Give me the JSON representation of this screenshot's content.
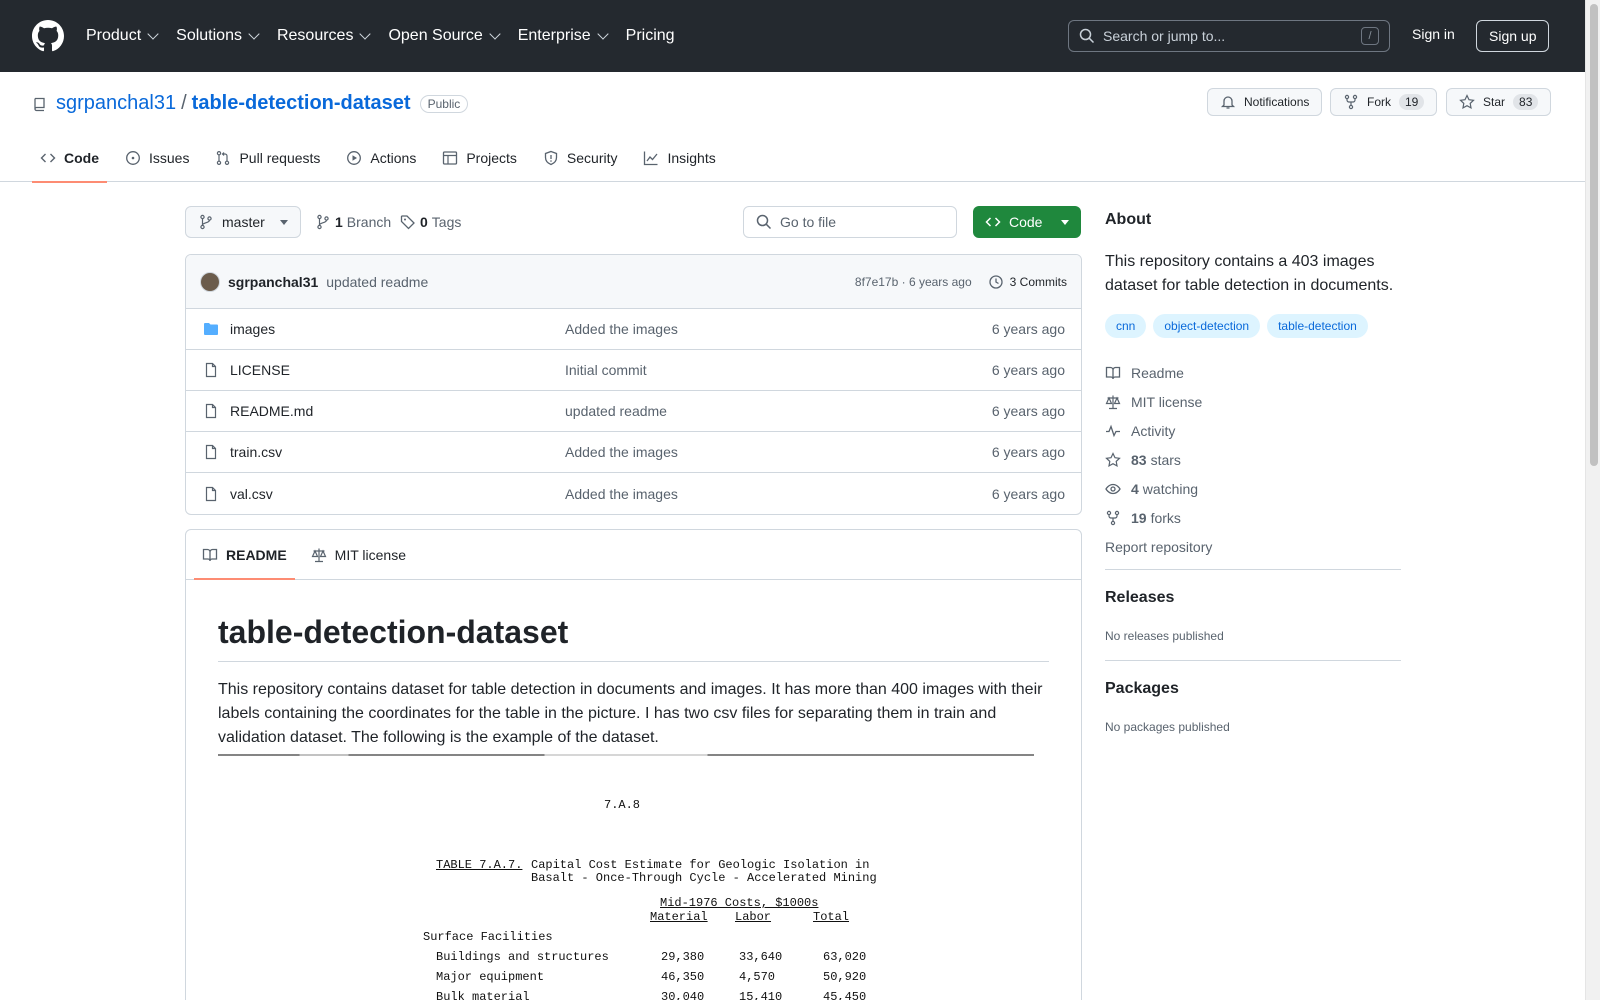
{
  "header": {
    "nav": [
      "Product",
      "Solutions",
      "Resources",
      "Open Source",
      "Enterprise",
      "Pricing"
    ],
    "search_placeholder": "Search or jump to...",
    "search_key": "/",
    "signin": "Sign in",
    "signup": "Sign up"
  },
  "repo": {
    "owner": "sgrpanchal31",
    "separator": "/",
    "name": "table-detection-dataset",
    "visibility": "Public",
    "notifications": "Notifications",
    "fork_label": "Fork",
    "fork_count": "19",
    "star_label": "Star",
    "star_count": "83",
    "tabs": [
      "Code",
      "Issues",
      "Pull requests",
      "Actions",
      "Projects",
      "Security",
      "Insights"
    ]
  },
  "branchbar": {
    "branch": "master",
    "branch_count": "1",
    "branch_word": "Branch",
    "tag_count": "0",
    "tag_word": "Tags",
    "goto_placeholder": "Go to file",
    "code_btn": "Code"
  },
  "commit": {
    "author": "sgrpanchal31",
    "message": "updated readme",
    "meta": "8f7e17b · 6 years ago",
    "commits": "3 Commits"
  },
  "files": [
    {
      "name": "images",
      "type": "folder",
      "message": "Added the images",
      "age": "6 years ago"
    },
    {
      "name": "LICENSE",
      "type": "file",
      "message": "Initial commit",
      "age": "6 years ago"
    },
    {
      "name": "README.md",
      "type": "file",
      "message": "updated readme",
      "age": "6 years ago"
    },
    {
      "name": "train.csv",
      "type": "file",
      "message": "Added the images",
      "age": "6 years ago"
    },
    {
      "name": "val.csv",
      "type": "file",
      "message": "Added the images",
      "age": "6 years ago"
    }
  ],
  "readme": {
    "tabs": [
      "README",
      "MIT license"
    ],
    "title": "table-detection-dataset",
    "paragraph": "This repository contains dataset for table detection in documents and images. It has more than 400 images with their labels containing the coordinates for the table in the picture. I has two csv files for separating them in train and validation dataset. The following is the example of the dataset.",
    "scan": {
      "page_no": "7.A.8",
      "table_ref": "TABLE 7.A.7.",
      "caption_1": "Capital Cost Estimate for Geologic Isolation in",
      "caption_2": "Basalt - Once-Through Cycle - Accelerated Mining",
      "costs_header": "Mid-1976 Costs, $1000s",
      "col_material": "Material",
      "col_labor": "Labor",
      "col_total": "Total",
      "section": "Surface Facilities",
      "rows": [
        {
          "label": "Buildings and structures",
          "material": "29,380",
          "labor": "33,640",
          "total": "63,020"
        },
        {
          "label": "Major equipment",
          "material": "46,350",
          "labor": "4,570",
          "total": "50,920"
        },
        {
          "label": "Bulk material",
          "material": "30,040",
          "labor": "15,410",
          "total": "45,450"
        }
      ]
    }
  },
  "sidebar": {
    "about_title": "About",
    "description": "This repository contains a 403 images dataset for table detection in documents.",
    "topics": [
      "cnn",
      "object-detection",
      "table-detection"
    ],
    "readme": "Readme",
    "license": "MIT license",
    "activity": "Activity",
    "stars_count": "83",
    "stars_word": "stars",
    "watching_count": "4",
    "watching_word": "watching",
    "forks_count": "19",
    "forks_word": "forks",
    "report": "Report repository",
    "releases_title": "Releases",
    "releases_text": "No releases published",
    "packages_title": "Packages",
    "packages_text": "No packages published"
  },
  "colors": {
    "header_bg": "#24292f",
    "link": "#0969da",
    "code_button": "#1f883d",
    "active_tab_underline": "#fd8c73",
    "topic_bg": "#ddf4ff"
  }
}
